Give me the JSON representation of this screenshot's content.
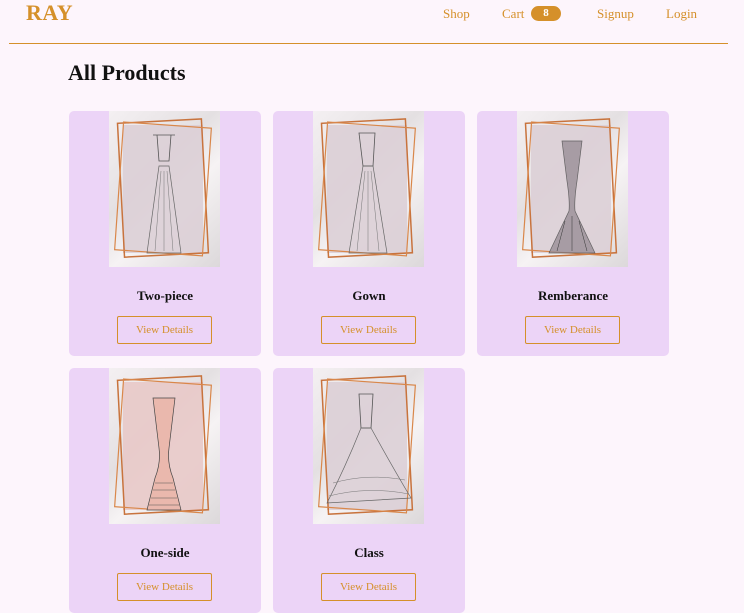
{
  "brand": "RAY",
  "nav": {
    "shop": "Shop",
    "cart": "Cart",
    "cart_count": "8",
    "signup": "Signup",
    "login": "Login"
  },
  "page_title": "All Products",
  "products": [
    {
      "name": "Two-piece",
      "button": "View Details"
    },
    {
      "name": "Gown",
      "button": "View Details"
    },
    {
      "name": "Remberance",
      "button": "View Details"
    },
    {
      "name": "One-side",
      "button": "View Details"
    },
    {
      "name": "Class",
      "button": "View Details"
    }
  ],
  "colors": {
    "accent": "#d5902a",
    "card_bg": "#ecd4f7",
    "page_bg": "#fdf5fc"
  }
}
